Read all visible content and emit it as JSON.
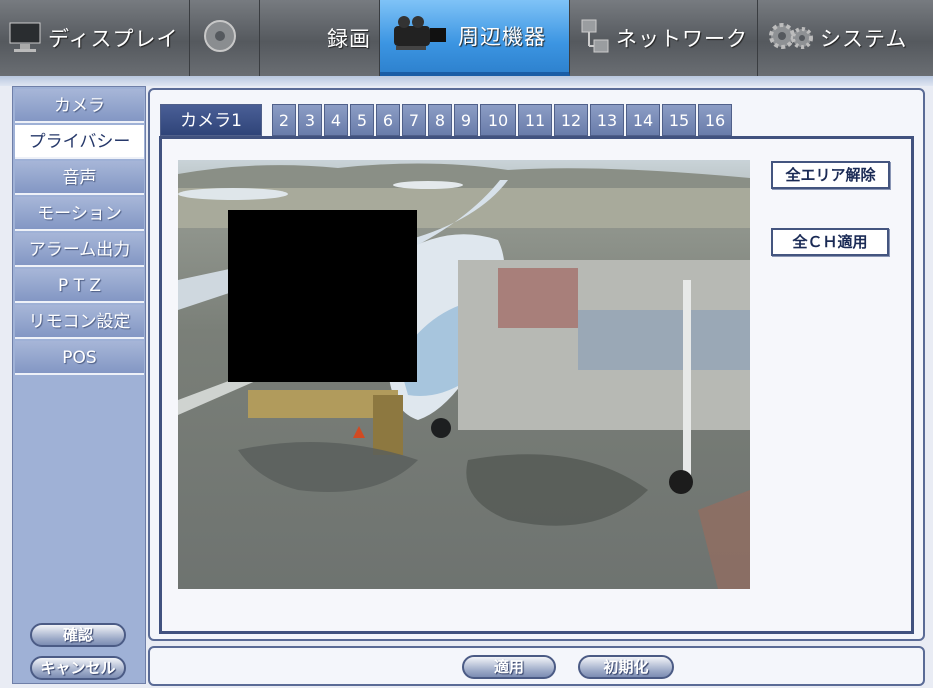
{
  "topmenu": {
    "items": [
      {
        "label": "ディスプレイ",
        "icon": "monitor-icon"
      },
      {
        "label": "",
        "icon": "disc-icon"
      },
      {
        "label": "録画",
        "icon": "record-icon"
      },
      {
        "label": "周辺機器",
        "icon": "camcorder-icon",
        "active": true
      },
      {
        "label": "ネットワーク",
        "icon": "network-icon"
      },
      {
        "label": "システム",
        "icon": "gears-icon"
      }
    ]
  },
  "sidebar": {
    "items": [
      {
        "label": "カメラ"
      },
      {
        "label": "プライバシー",
        "active": true
      },
      {
        "label": "音声"
      },
      {
        "label": "モーション"
      },
      {
        "label": "アラーム出力"
      },
      {
        "label": "P T Z"
      },
      {
        "label": "リモコン設定"
      },
      {
        "label": "POS"
      }
    ],
    "confirm_label": "確認",
    "cancel_label": "キャンセル"
  },
  "tabs": [
    "カメラ1",
    "2",
    "3",
    "4",
    "5",
    "6",
    "7",
    "8",
    "9",
    "10",
    "11",
    "12",
    "13",
    "14",
    "15",
    "16"
  ],
  "buttons": {
    "clear_all_label": "全エリア解除",
    "apply_all_ch_label": "全ＣＨ適用",
    "apply_label": "適用",
    "reset_label": "初期化"
  },
  "colors": {
    "accent": "#3c95e2",
    "sidebar": "#8397c4",
    "border": "#41527f",
    "mask": "#000000"
  }
}
